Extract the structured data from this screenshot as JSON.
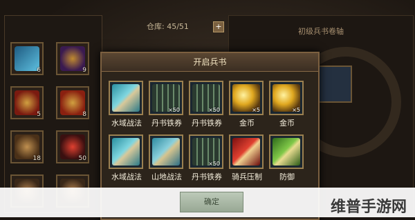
{
  "window": {
    "warehouse_label": "仓库: 45/51",
    "add_symbol": "+",
    "right_panel_title": "初级兵书卷轴"
  },
  "inventory": {
    "slots": [
      {
        "icon": "blue-scroll-icon",
        "count": "6"
      },
      {
        "icon": "purple-pouch-icon",
        "count": "9"
      },
      {
        "icon": "red-armor-icon",
        "count": "5"
      },
      {
        "icon": "red-armor-icon",
        "count": "8"
      },
      {
        "icon": "bronze-armor-icon",
        "count": "18"
      },
      {
        "icon": "red-helmet-icon",
        "count": "50"
      },
      {
        "icon": "bronze-emblem-icon",
        "count": ""
      },
      {
        "icon": "bronze-emblem-icon",
        "count": ""
      }
    ]
  },
  "modal": {
    "title": "开启兵书",
    "items": [
      {
        "label": "水域战法",
        "qty": "",
        "icon": "water-scroll-icon"
      },
      {
        "label": "丹书铁券",
        "qty": "×50",
        "icon": "iron-coupon-icon"
      },
      {
        "label": "丹书铁券",
        "qty": "×50",
        "icon": "iron-coupon-icon"
      },
      {
        "label": "金币",
        "qty": "×5",
        "icon": "gold-coin-icon"
      },
      {
        "label": "金币",
        "qty": "×5",
        "icon": "gold-coin-icon"
      },
      {
        "label": "水域战法",
        "qty": "",
        "icon": "water-scroll-icon"
      },
      {
        "label": "山地战法",
        "qty": "",
        "icon": "mountain-scroll-icon"
      },
      {
        "label": "丹书铁券",
        "qty": "×50",
        "icon": "iron-coupon-icon"
      },
      {
        "label": "骑兵压制",
        "qty": "",
        "icon": "cavalry-scroll-icon"
      },
      {
        "label": "防御",
        "qty": "",
        "icon": "defense-scroll-icon"
      }
    ],
    "confirm_label": "确定"
  },
  "watermark": "维普手游网",
  "colors": {
    "frame": "#9b8050",
    "modal_bg": "#2c241b",
    "text": "#f4eedc"
  }
}
